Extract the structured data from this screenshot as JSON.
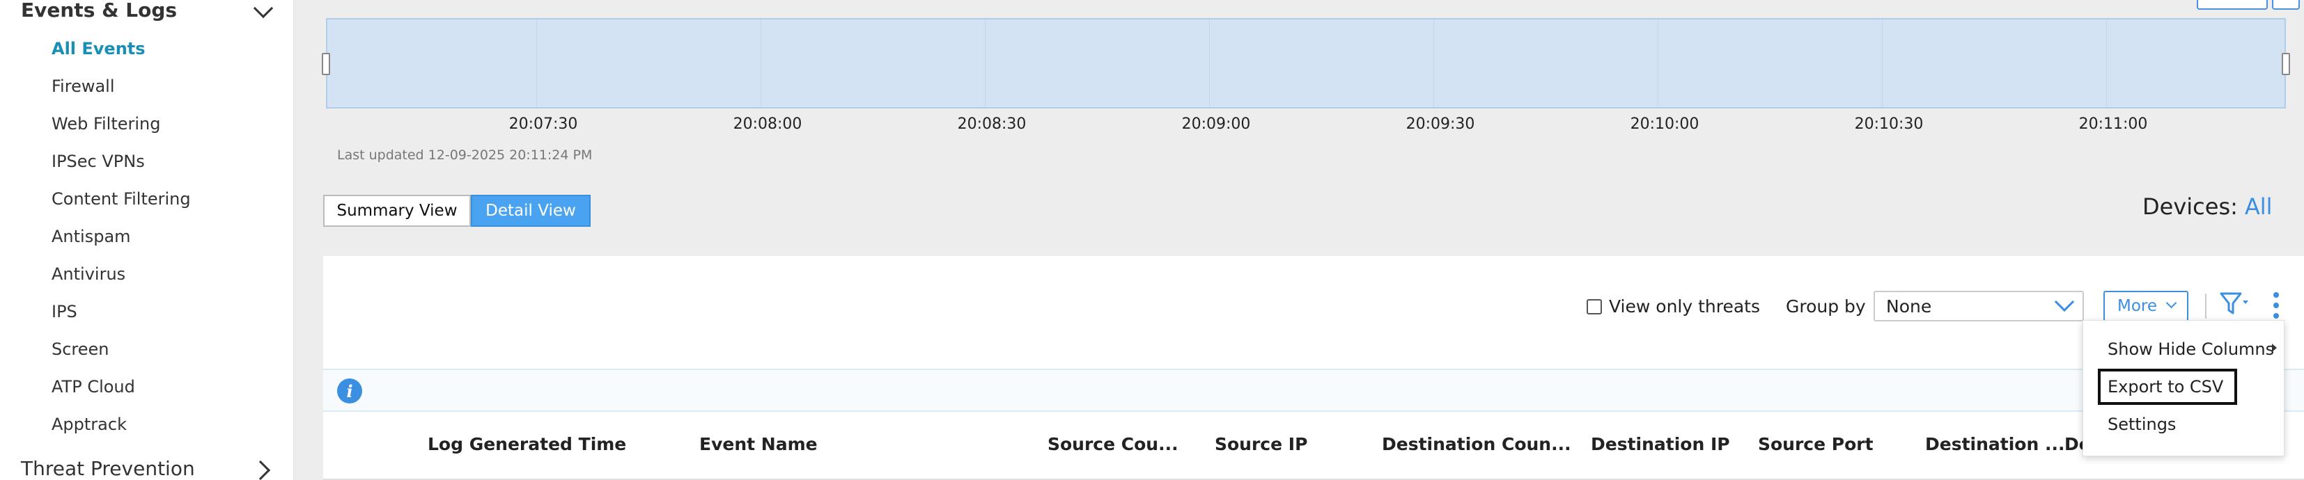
{
  "sidebar": {
    "section_title": "Events & Logs",
    "items": [
      {
        "label": "All Events",
        "active": true
      },
      {
        "label": "Firewall"
      },
      {
        "label": "Web Filtering"
      },
      {
        "label": "IPSec VPNs"
      },
      {
        "label": "Content Filtering"
      },
      {
        "label": "Antispam"
      },
      {
        "label": "Antivirus"
      },
      {
        "label": "IPS"
      },
      {
        "label": "Screen"
      },
      {
        "label": "ATP Cloud"
      },
      {
        "label": "Apptrack"
      }
    ],
    "next_section_title": "Threat Prevention"
  },
  "timeline": {
    "ticks": [
      "20:07:30",
      "20:08:00",
      "20:08:30",
      "20:09:00",
      "20:09:30",
      "20:10:00",
      "20:10:30",
      "20:11:00"
    ],
    "last_updated": "Last updated 12-09-2025 20:11:24 PM"
  },
  "view_toggle": {
    "summary_label": "Summary View",
    "detail_label": "Detail View",
    "selected": "Detail View"
  },
  "devices": {
    "label": "Devices:",
    "value": "All"
  },
  "toolbar": {
    "view_only_threats_label": "View only threats",
    "view_only_threats_checked": false,
    "group_by_label": "Group by",
    "group_by_value": "None",
    "more_label": "More"
  },
  "more_menu": {
    "items": [
      {
        "label": "Show Hide Columns",
        "has_submenu": true
      },
      {
        "label": "Export to CSV",
        "focused": true
      },
      {
        "label": "Settings"
      }
    ]
  },
  "table": {
    "columns": [
      "Log Generated Time",
      "Event Name",
      "Source Cou...",
      "Source IP",
      "Destination Coun...",
      "Destination IP",
      "Source Port",
      "Destination ...",
      "De"
    ]
  },
  "colors": {
    "accent": "#3b8fe0",
    "active_nav": "#1a8fb6",
    "timeline_fill": "#d3e3f4",
    "detail_button": "#4aa3f0"
  }
}
